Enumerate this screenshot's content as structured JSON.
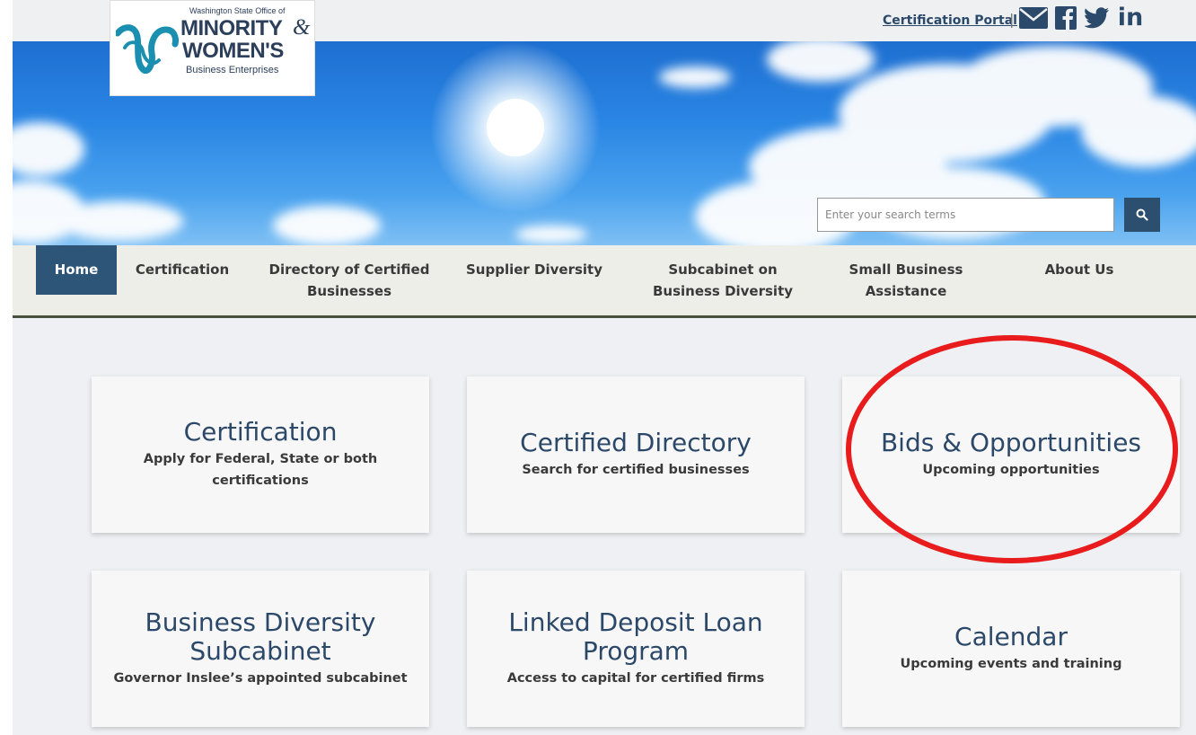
{
  "header": {
    "portal_link": "Certification Portal",
    "separator": "|",
    "social_icons": [
      "email-icon",
      "facebook-icon",
      "twitter-icon",
      "linkedin-icon"
    ],
    "linkedin_text": "in"
  },
  "logo": {
    "small_text": "Washington State Office of",
    "line1": "MINORITY",
    "ampersand": "&",
    "line2": "WOMEN'S",
    "line3": "Business Enterprises"
  },
  "search": {
    "placeholder": "Enter your search terms",
    "button_icon": "search-icon"
  },
  "nav": {
    "items": [
      {
        "label": "Home",
        "active": true
      },
      {
        "label": "Certification"
      },
      {
        "label": "Directory of Certified Businesses"
      },
      {
        "label": "Supplier Diversity"
      },
      {
        "label": "Subcabinet on Business Diversity"
      },
      {
        "label": "Small Business Assistance"
      },
      {
        "label": "About Us"
      }
    ]
  },
  "tiles": [
    {
      "title": "Certification",
      "subtitle": "Apply for Federal, State or both certifications"
    },
    {
      "title": "Certified Directory",
      "subtitle": "Search for certified businesses"
    },
    {
      "title": "Bids & Opportunities",
      "subtitle": "Upcoming opportunities"
    },
    {
      "title": "Business Diversity Subcabinet",
      "subtitle": "Governor Inslee’s appointed subcabinet"
    },
    {
      "title": "Linked Deposit Loan Program",
      "subtitle": "Access to capital for certified firms"
    },
    {
      "title": "Calendar",
      "subtitle": "Upcoming events and training"
    }
  ],
  "colors": {
    "nav_active": "#2d5577",
    "tile_title": "#2c4868",
    "annotation": "#e81c1c"
  }
}
